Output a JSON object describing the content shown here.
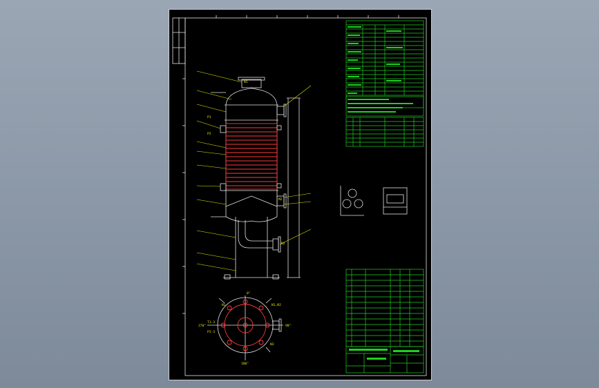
{
  "drawing": {
    "nozzles_elevation": [
      "N1",
      "P1",
      "P2",
      "M2",
      "N2"
    ],
    "nozzles_plan": [
      "N1",
      "N1,N2",
      "N3",
      "T1-3",
      "P1-3"
    ],
    "plan_angles": [
      "0°",
      "90°",
      "270°",
      "180°"
    ]
  },
  "colors": {
    "background": "#8a97a6",
    "sheet": "#000000",
    "frame": "#e6e6e6",
    "table_lines": "#1fd21f",
    "tubes": "#ff3a3a",
    "labels": "#e8e800"
  }
}
